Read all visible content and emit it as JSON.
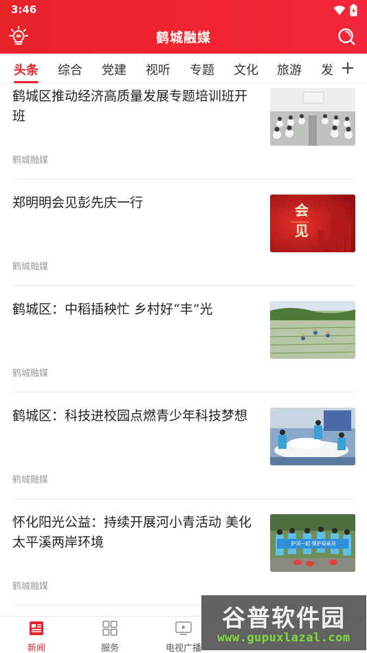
{
  "status_bar": {
    "time": "3:46"
  },
  "app_bar": {
    "title": "鹤城融媒"
  },
  "tabs": [
    {
      "label": "头条",
      "active": true
    },
    {
      "label": "综合"
    },
    {
      "label": "党建"
    },
    {
      "label": "视听"
    },
    {
      "label": "专题"
    },
    {
      "label": "文化"
    },
    {
      "label": "旅游"
    },
    {
      "label": "发"
    }
  ],
  "tab_add_label": "+",
  "feed": [
    {
      "title": "鹤城区推动经济高质量发展专题培训班开班",
      "source": "鹤城融媒",
      "thumb": "meeting-room-photo"
    },
    {
      "title": "郑明明会见彭先庆一行",
      "source": "鹤城融媒",
      "thumb": "red-meeting-graphic",
      "thumb_text": "会见"
    },
    {
      "title": "鹤城区：中稻插秧忙 乡村好“丰”光",
      "source": "鹤城融媒",
      "thumb": "rice-field-photo"
    },
    {
      "title": "鹤城区：科技进校园点燃青少年科技梦想",
      "source": "鹤城融媒",
      "thumb": "science-classroom-photo"
    },
    {
      "title": "怀化阳光公益：持续开展河小青活动 美化太平溪两岸环境",
      "source": "鹤城融媒",
      "thumb": "volunteers-banner-photo",
      "thumb_text": "护河一起·保护母亲河"
    }
  ],
  "bottom_nav": [
    {
      "label": "新闻",
      "icon": "newspaper-icon",
      "active": true
    },
    {
      "label": "服务",
      "icon": "grid-icon"
    },
    {
      "label": "电视广播",
      "icon": "tv-icon"
    }
  ],
  "watermark": {
    "main": "谷普软件园",
    "url": "www.gupuxlazal.com"
  },
  "colors": {
    "brand_red": "#e8232a",
    "source_gray": "#999999",
    "divider": "#e6e6e6"
  }
}
